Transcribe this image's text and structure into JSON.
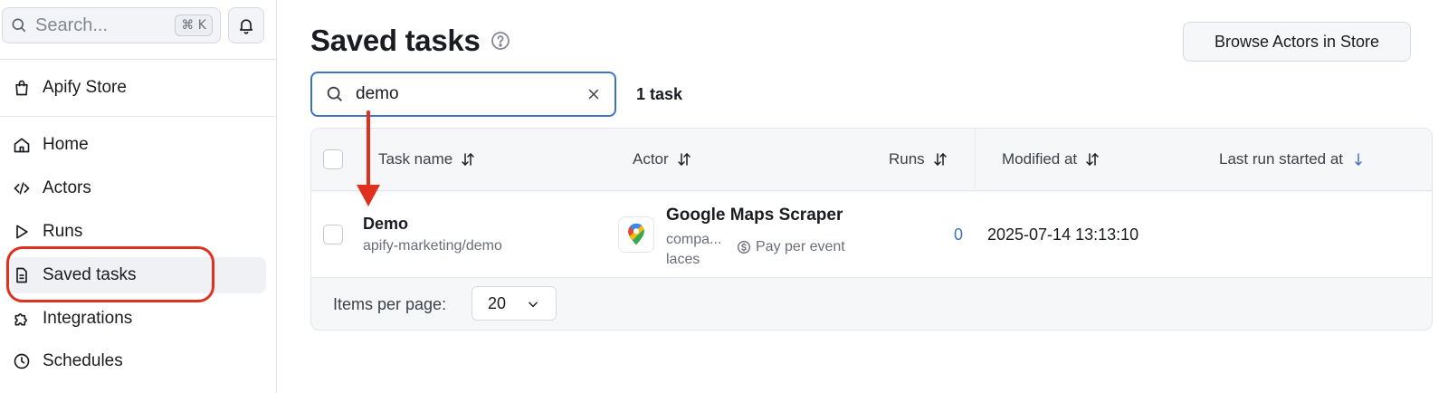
{
  "sidebar": {
    "search_placeholder": "Search...",
    "search_shortcut": "⌘ K",
    "items": [
      {
        "label": "Apify Store",
        "icon": "shopping-bag-icon"
      },
      {
        "label": "Home",
        "icon": "home-icon"
      },
      {
        "label": "Actors",
        "icon": "code-icon"
      },
      {
        "label": "Runs",
        "icon": "play-icon"
      },
      {
        "label": "Saved tasks",
        "icon": "document-icon",
        "active": true
      },
      {
        "label": "Integrations",
        "icon": "puzzle-icon"
      },
      {
        "label": "Schedules",
        "icon": "clock-icon"
      }
    ]
  },
  "main": {
    "title": "Saved tasks",
    "browse_button": "Browse Actors in Store",
    "filter_value": "demo",
    "task_count": "1 task",
    "columns": {
      "task_name": "Task name",
      "actor": "Actor",
      "runs": "Runs",
      "modified_at": "Modified at",
      "last_run": "Last run started at"
    },
    "rows": [
      {
        "task_name": "Demo",
        "task_path": "apify-marketing/demo",
        "actor_name": "Google Maps Scraper",
        "actor_user": "compa... laces",
        "pricing": "Pay per event",
        "runs": "0",
        "modified_at": "2025-07-14 13:13:10"
      }
    ],
    "items_per_page_label": "Items per page:",
    "items_per_page_value": "20"
  },
  "colors": {
    "accent": "#3f73c8",
    "annotation": "#e0301e"
  }
}
